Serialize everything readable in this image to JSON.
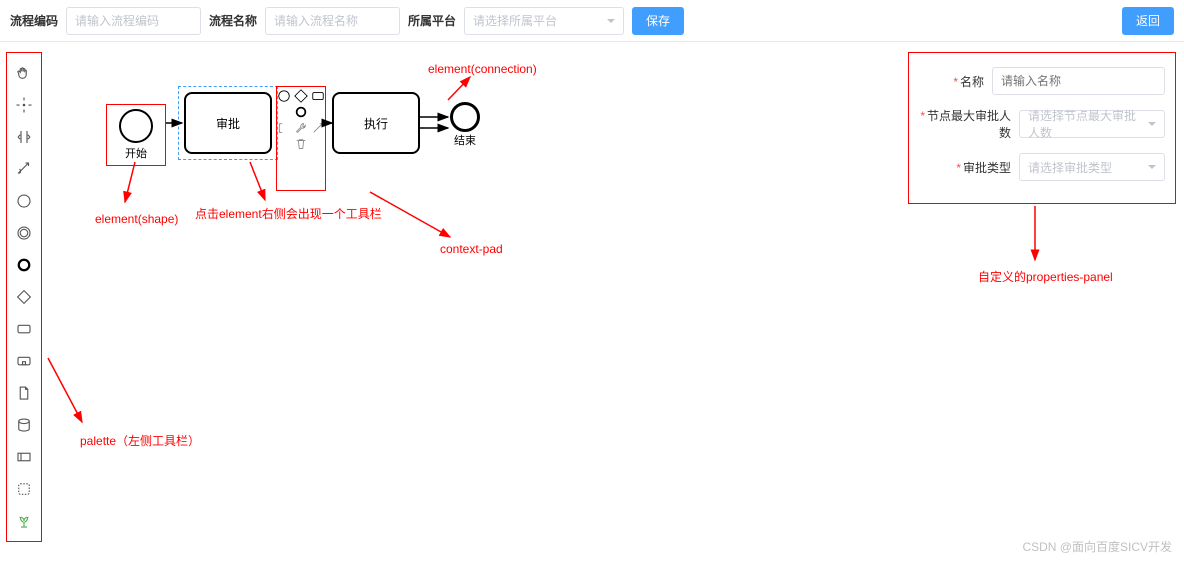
{
  "header": {
    "code_label": "流程编码",
    "code_placeholder": "请输入流程编码",
    "name_label": "流程名称",
    "name_placeholder": "请输入流程名称",
    "platform_label": "所属平台",
    "platform_placeholder": "请选择所属平台",
    "save": "保存",
    "back": "返回"
  },
  "canvas": {
    "start_label": "开始",
    "approve_label": "审批",
    "exec_label": "执行",
    "end_label": "结束"
  },
  "annotations": {
    "connection": "element(connection)",
    "shape": "element(shape)",
    "context_click": "点击element右侧会出现一个工具栏",
    "context_pad": "context-pad",
    "palette": "palette（左侧工具栏）",
    "props_panel": "自定义的properties-panel"
  },
  "props": {
    "name_label": "名称",
    "name_placeholder": "请输入名称",
    "max_label": "节点最大审批人数",
    "max_placeholder": "请选择节点最大审批人数",
    "type_label": "审批类型",
    "type_placeholder": "请选择审批类型"
  },
  "watermark": "CSDN @面向百度SICV开发"
}
